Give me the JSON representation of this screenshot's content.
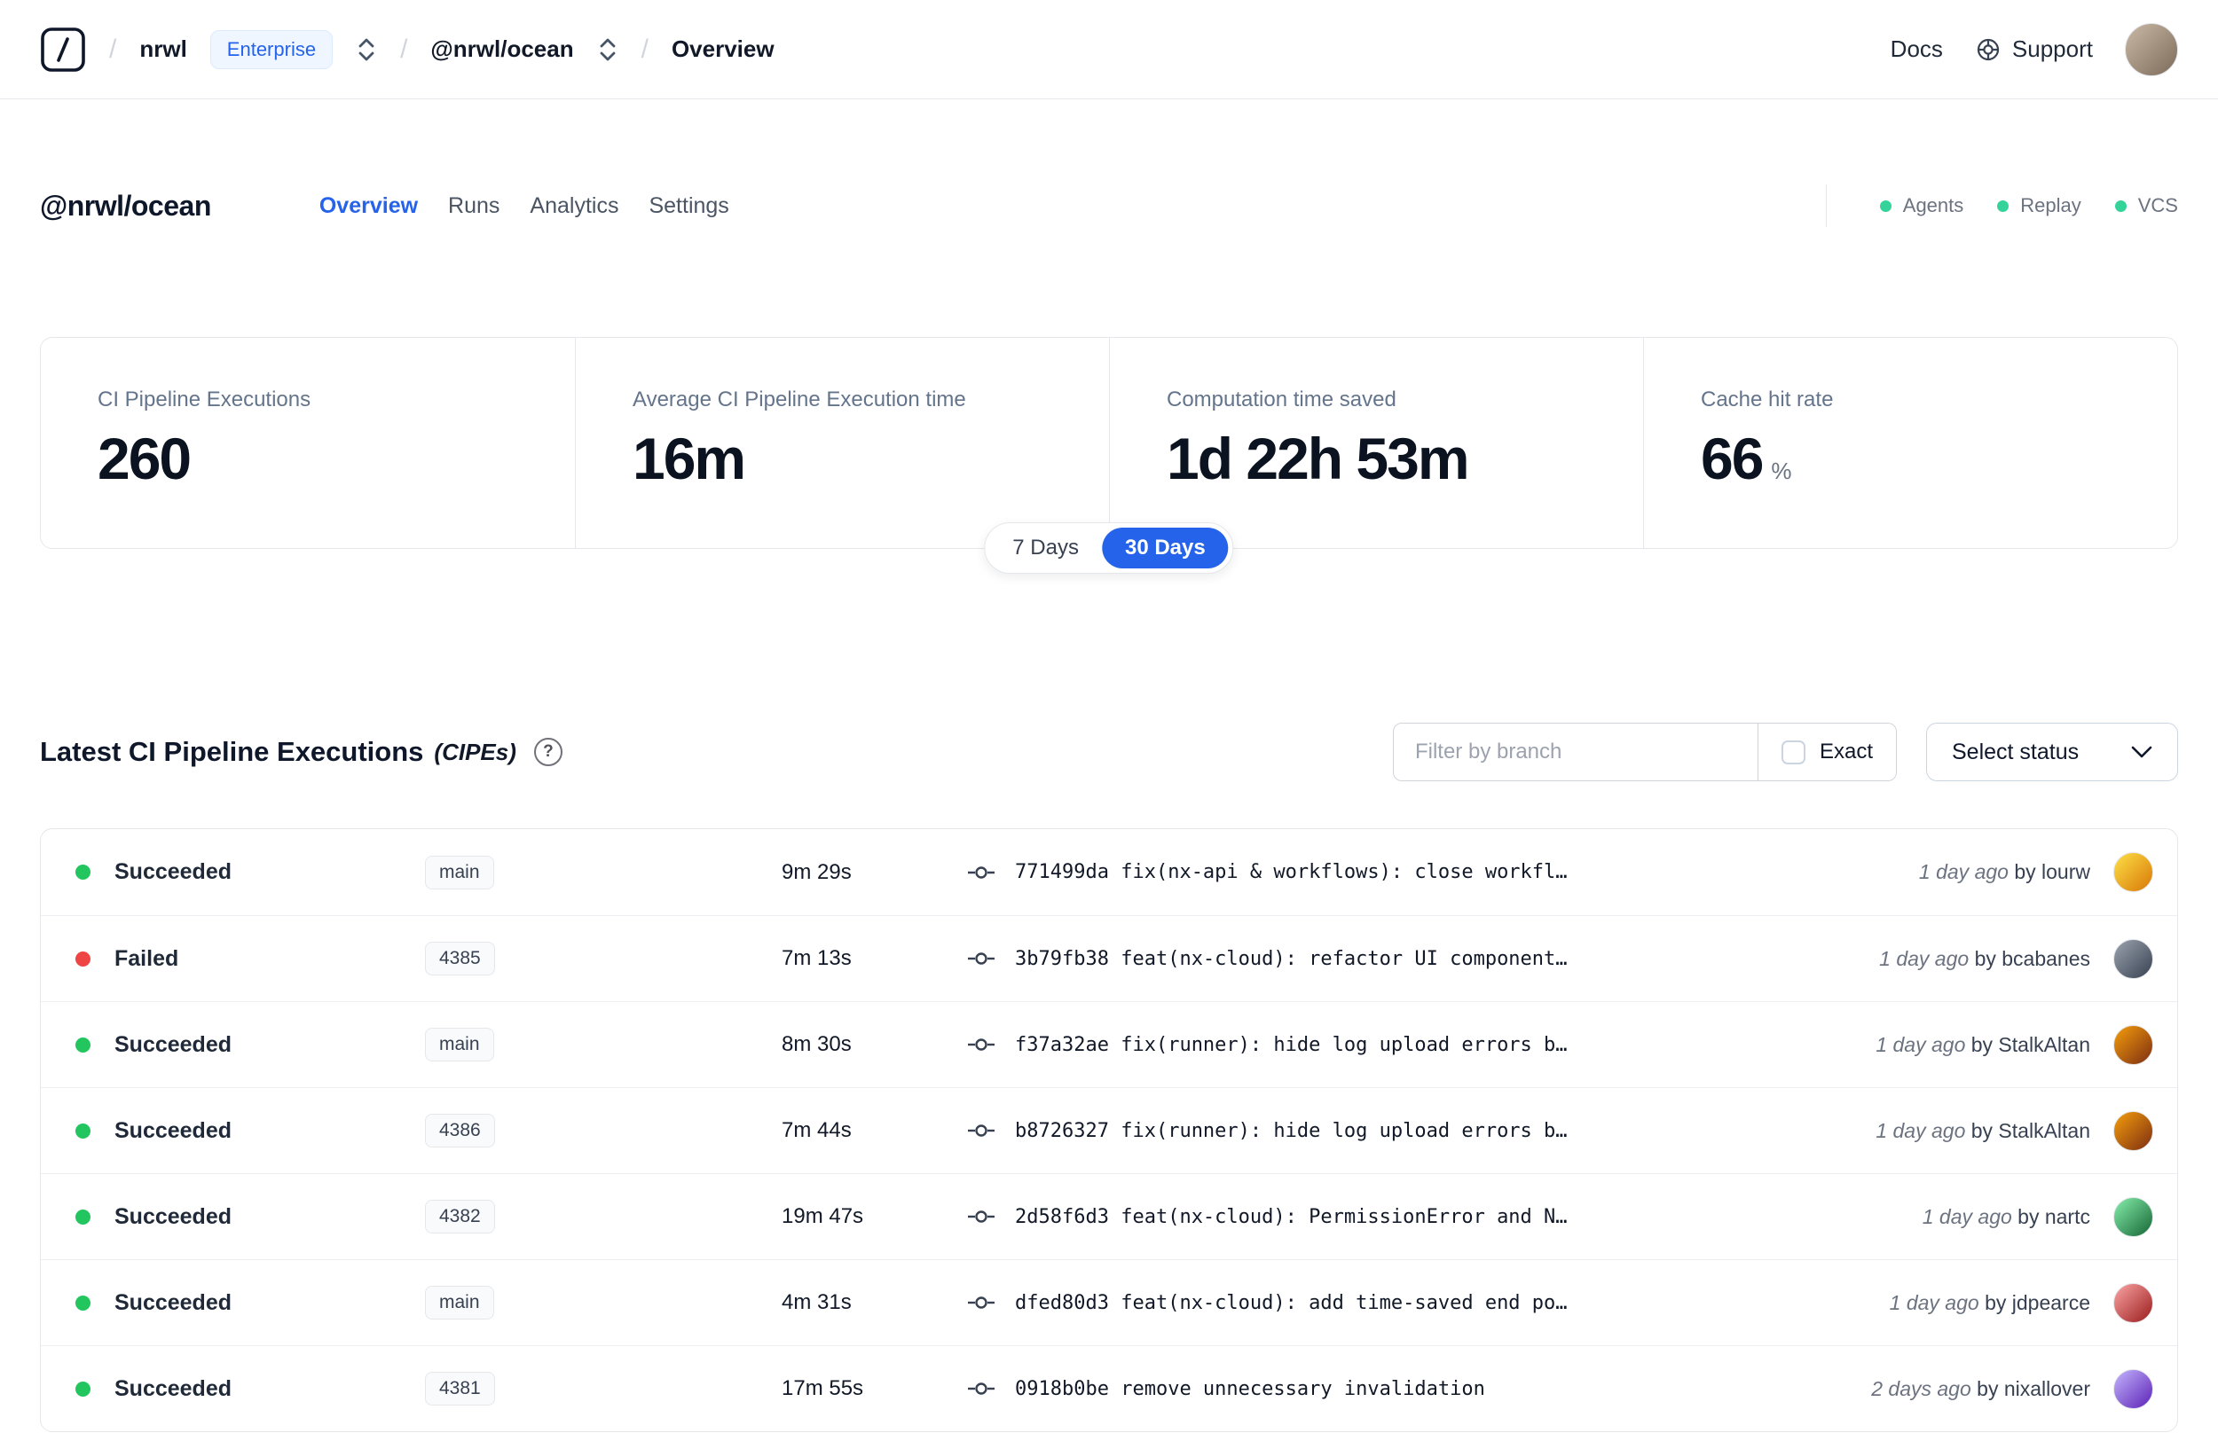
{
  "colors": {
    "accent": "#2563eb",
    "success": "#22c55e",
    "danger": "#ef4444",
    "header_status": "#34d399"
  },
  "navbar": {
    "separator": "/",
    "org": "nrwl",
    "org_badge": "Enterprise",
    "workspace": "@nrwl/ocean",
    "page": "Overview",
    "docs_label": "Docs",
    "support_label": "Support"
  },
  "header": {
    "workspace_title": "@nrwl/ocean",
    "tabs": [
      {
        "label": "Overview",
        "active": true
      },
      {
        "label": "Runs",
        "active": false
      },
      {
        "label": "Analytics",
        "active": false
      },
      {
        "label": "Settings",
        "active": false
      }
    ],
    "statuses": [
      {
        "label": "Agents"
      },
      {
        "label": "Replay"
      },
      {
        "label": "VCS"
      }
    ]
  },
  "stats": {
    "cards": [
      {
        "label": "CI Pipeline Executions",
        "value": "260",
        "suffix": ""
      },
      {
        "label": "Average CI Pipeline Execution time",
        "value": "16m",
        "suffix": ""
      },
      {
        "label": "Computation time saved",
        "value": "1d 22h 53m",
        "suffix": ""
      },
      {
        "label": "Cache hit rate",
        "value": "66",
        "suffix": "%"
      }
    ],
    "range_toggle": [
      {
        "label": "7 Days",
        "active": false
      },
      {
        "label": "30 Days",
        "active": true
      }
    ]
  },
  "cipes": {
    "title": "Latest CI Pipeline Executions",
    "title_suffix": "(CIPEs)",
    "help_glyph": "?",
    "filter_placeholder": "Filter by branch",
    "exact_label": "Exact",
    "select_status_label": "Select status",
    "rows": [
      {
        "status": "Succeeded",
        "status_color": "success",
        "branch": "main",
        "duration": "9m 29s",
        "commit_hash": "771499da",
        "commit_message": "fix(nx-api & workflows): close workfl…",
        "time": "1 day ago",
        "author": "by lourw",
        "avatar": [
          "#fde047",
          "#d97706"
        ]
      },
      {
        "status": "Failed",
        "status_color": "danger",
        "branch": "4385",
        "duration": "7m 13s",
        "commit_hash": "3b79fb38",
        "commit_message": "feat(nx-cloud): refactor UI component…",
        "time": "1 day ago",
        "author": "by bcabanes",
        "avatar": [
          "#9ca3af",
          "#374151"
        ]
      },
      {
        "status": "Succeeded",
        "status_color": "success",
        "branch": "main",
        "duration": "8m 30s",
        "commit_hash": "f37a32ae",
        "commit_message": "fix(runner): hide log upload errors b…",
        "time": "1 day ago",
        "author": "by StalkAltan",
        "avatar": [
          "#f59e0b",
          "#7c2d12"
        ]
      },
      {
        "status": "Succeeded",
        "status_color": "success",
        "branch": "4386",
        "duration": "7m 44s",
        "commit_hash": "b8726327",
        "commit_message": "fix(runner): hide log upload errors b…",
        "time": "1 day ago",
        "author": "by StalkAltan",
        "avatar": [
          "#f59e0b",
          "#7c2d12"
        ]
      },
      {
        "status": "Succeeded",
        "status_color": "success",
        "branch": "4382",
        "duration": "19m 47s",
        "commit_hash": "2d58f6d3",
        "commit_message": "feat(nx-cloud): PermissionError and N…",
        "time": "1 day ago",
        "author": "by nartc",
        "avatar": [
          "#86efac",
          "#166534"
        ]
      },
      {
        "status": "Succeeded",
        "status_color": "success",
        "branch": "main",
        "duration": "4m 31s",
        "commit_hash": "dfed80d3",
        "commit_message": "feat(nx-cloud): add time-saved end po…",
        "time": "1 day ago",
        "author": "by jdpearce",
        "avatar": [
          "#fca5a5",
          "#991b1b"
        ]
      },
      {
        "status": "Succeeded",
        "status_color": "success",
        "branch": "4381",
        "duration": "17m 55s",
        "commit_hash": "0918b0be",
        "commit_message": "remove unnecessary invalidation",
        "time": "2 days ago",
        "author": "by nixallover",
        "avatar": [
          "#c4b5fd",
          "#5b21b6"
        ]
      }
    ]
  }
}
